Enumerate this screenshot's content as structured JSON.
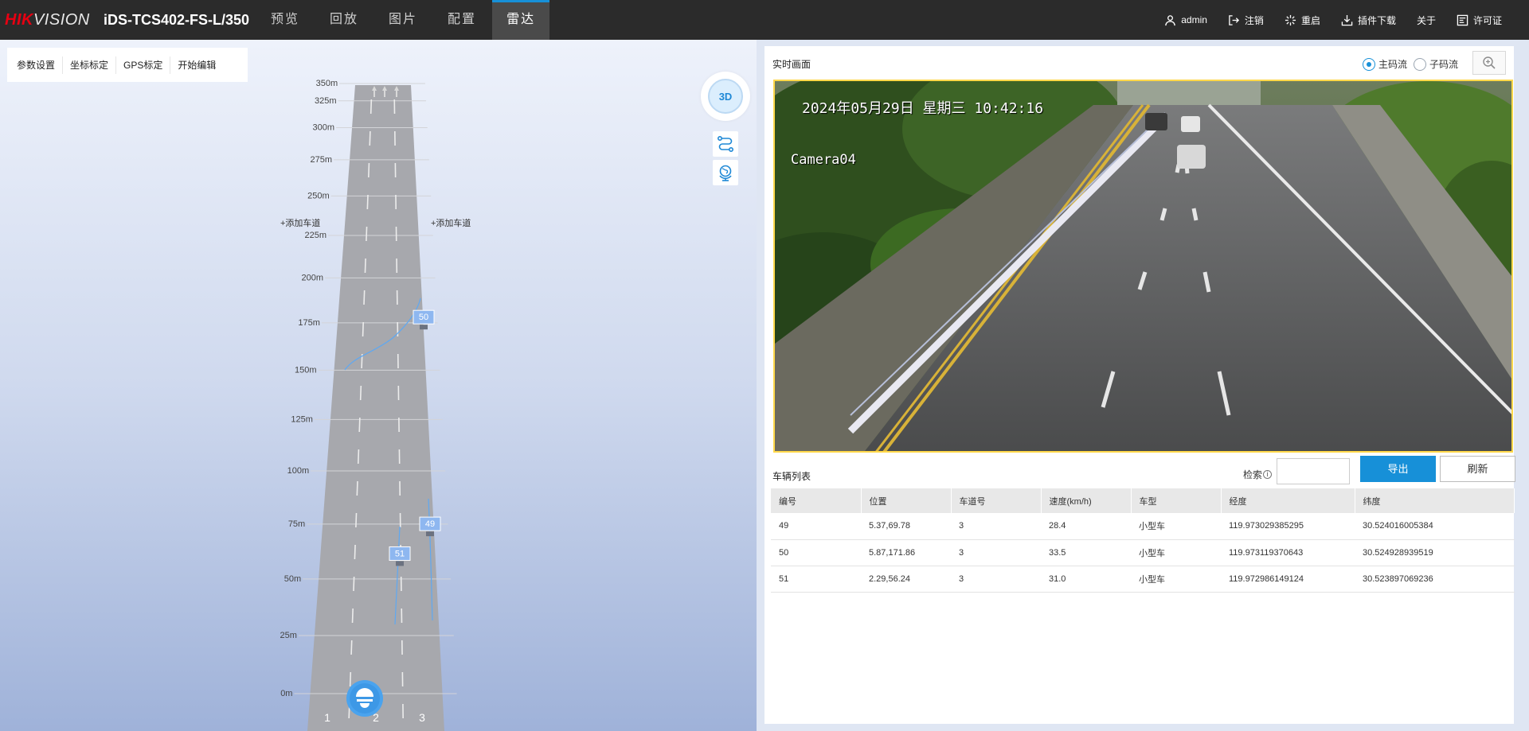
{
  "header": {
    "logo_brand_red": "HIK",
    "logo_brand_rest": "VISION",
    "model": "iDS-TCS402-FS-L/350",
    "nav_tabs": [
      {
        "label": "预览",
        "active": false
      },
      {
        "label": "回放",
        "active": false
      },
      {
        "label": "图片",
        "active": false
      },
      {
        "label": "配置",
        "active": false
      },
      {
        "label": "雷达",
        "active": true
      }
    ],
    "right_items": [
      {
        "label": "admin",
        "icon": "user-icon"
      },
      {
        "label": "注销",
        "icon": "logout-icon"
      },
      {
        "label": "重启",
        "icon": "restart-icon"
      },
      {
        "label": "插件下载",
        "icon": "download-icon"
      },
      {
        "label": "关于",
        "icon": ""
      },
      {
        "label": "许可证",
        "icon": "license-icon"
      }
    ]
  },
  "radar": {
    "toolbar": [
      "参数设置",
      "坐标标定",
      "GPS标定",
      "开始编辑"
    ],
    "distance_labels": [
      "350m",
      "325m",
      "300m",
      "275m",
      "250m",
      "225m",
      "200m",
      "175m",
      "150m",
      "125m",
      "100m",
      "75m",
      "50m",
      "25m",
      "0m"
    ],
    "add_lane_left": "+添加车道",
    "add_lane_right": "+添加车道",
    "lane_numbers": [
      "1",
      "2",
      "3"
    ],
    "targets": [
      {
        "id": "50",
        "distance_m": 171.86
      },
      {
        "id": "49",
        "distance_m": 69.78
      },
      {
        "id": "51",
        "distance_m": 56.24
      }
    ],
    "view_mode_label": "3D",
    "side_tools": [
      {
        "name": "track-tool",
        "icon": "track-route-icon"
      },
      {
        "name": "map-tool",
        "icon": "globe-icon"
      }
    ],
    "colors": {
      "road": "#a7a8ad",
      "target_badge": "#8eb7f0",
      "track": "#5ea8f2",
      "radar_device": "#4aa3ee"
    }
  },
  "live_view": {
    "title": "实时画面",
    "stream_options": [
      {
        "label": "主码流",
        "selected": true
      },
      {
        "label": "子码流",
        "selected": false
      }
    ],
    "osd_time": "2024年05月29日  星期三  10:42:16",
    "osd_camera": "Camera04",
    "border_color": "#ffd84a"
  },
  "vehicle_list": {
    "title": "车辆列表",
    "search_label": "检索",
    "search_value": "",
    "export_label": "导出",
    "refresh_label": "刷新",
    "columns": [
      "编号",
      "位置",
      "车道号",
      "速度(km/h)",
      "车型",
      "经度",
      "纬度"
    ],
    "rows": [
      [
        "49",
        "5.37,69.78",
        "3",
        "28.4",
        "小型车",
        "119.973029385295",
        "30.524016005384"
      ],
      [
        "50",
        "5.87,171.86",
        "3",
        "33.5",
        "小型车",
        "119.973119370643",
        "30.524928939519"
      ],
      [
        "51",
        "2.29,56.24",
        "3",
        "31.0",
        "小型车",
        "119.972986149124",
        "30.523897069236"
      ]
    ]
  }
}
